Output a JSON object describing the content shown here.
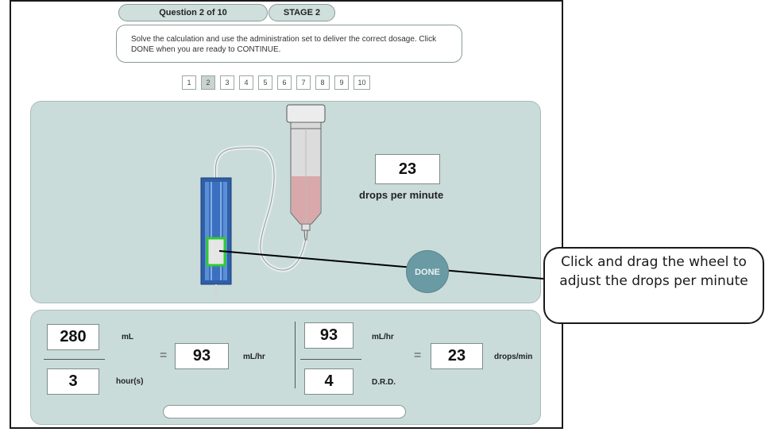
{
  "header": {
    "question_label": "Question 2 of 10",
    "stage_label": "STAGE 2",
    "instructions": "Solve the calculation and use the administration set to deliver the correct dosage. Click DONE when you are ready to CONTINUE."
  },
  "question_nav": {
    "items": [
      "1",
      "2",
      "3",
      "4",
      "5",
      "6",
      "7",
      "8",
      "9",
      "10"
    ],
    "active": "2"
  },
  "simulation": {
    "drops_per_minute_value": "23",
    "drops_per_minute_label": "drops per minute",
    "done_label": "DONE"
  },
  "callout": {
    "text": "Click and drag the wheel to adjust the drops per minute"
  },
  "calculation": {
    "volume_value": "280",
    "volume_unit": "mL",
    "time_value": "3",
    "time_unit": "hour(s)",
    "rate_value": "93",
    "rate_unit": "mL/hr",
    "rate2_value": "93",
    "rate2_unit": "mL/hr",
    "drd_value": "4",
    "drd_unit": "D.R.D.",
    "result_value": "23",
    "result_unit": "drops/min",
    "equals": "="
  },
  "colors": {
    "panel": "#c9dcda",
    "done_button": "#6a9aa3",
    "wheel_highlight": "#2ecc2e",
    "fluid": "#d9a8aa",
    "admin_set": "#3a6fb0"
  }
}
